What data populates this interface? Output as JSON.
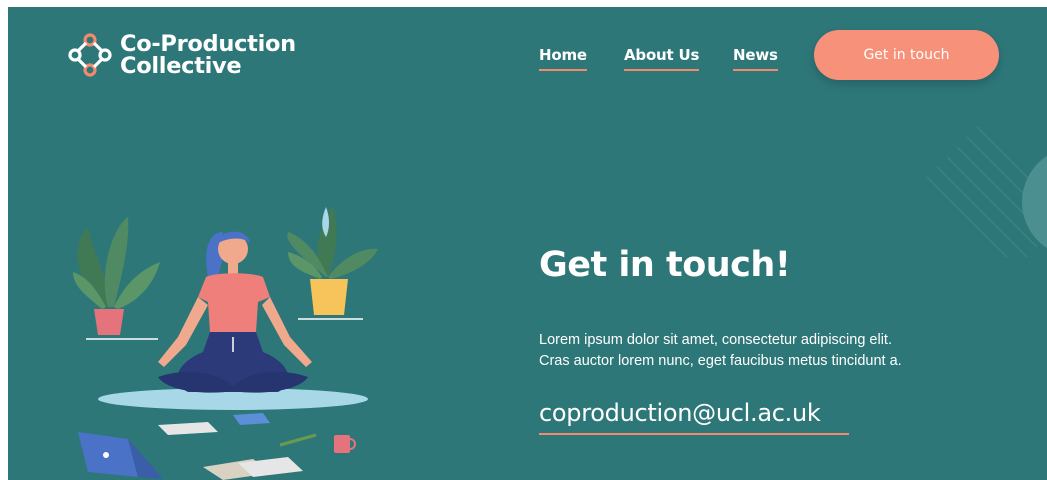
{
  "brand": {
    "name_line1": "Co-Production",
    "name_line2": "Collective"
  },
  "nav": {
    "items": [
      {
        "label": "Home"
      },
      {
        "label": "About Us"
      },
      {
        "label": "News"
      }
    ],
    "cta_label": "Get in touch"
  },
  "hero": {
    "title": "Get in touch!",
    "body_line1": "Lorem ipsum dolor sit amet, consectetur adipiscing elit.",
    "body_line2": "Cras auctor lorem nunc, eget faucibus metus tincidunt a.",
    "email": "coproduction@ucl.ac.uk"
  },
  "colors": {
    "background": "#2e7779",
    "accent": "#f8917a",
    "underline": "#f38a6e",
    "text": "#ffffff"
  },
  "icons": [
    "logo-diamond-icon",
    "meditation-illustration"
  ]
}
